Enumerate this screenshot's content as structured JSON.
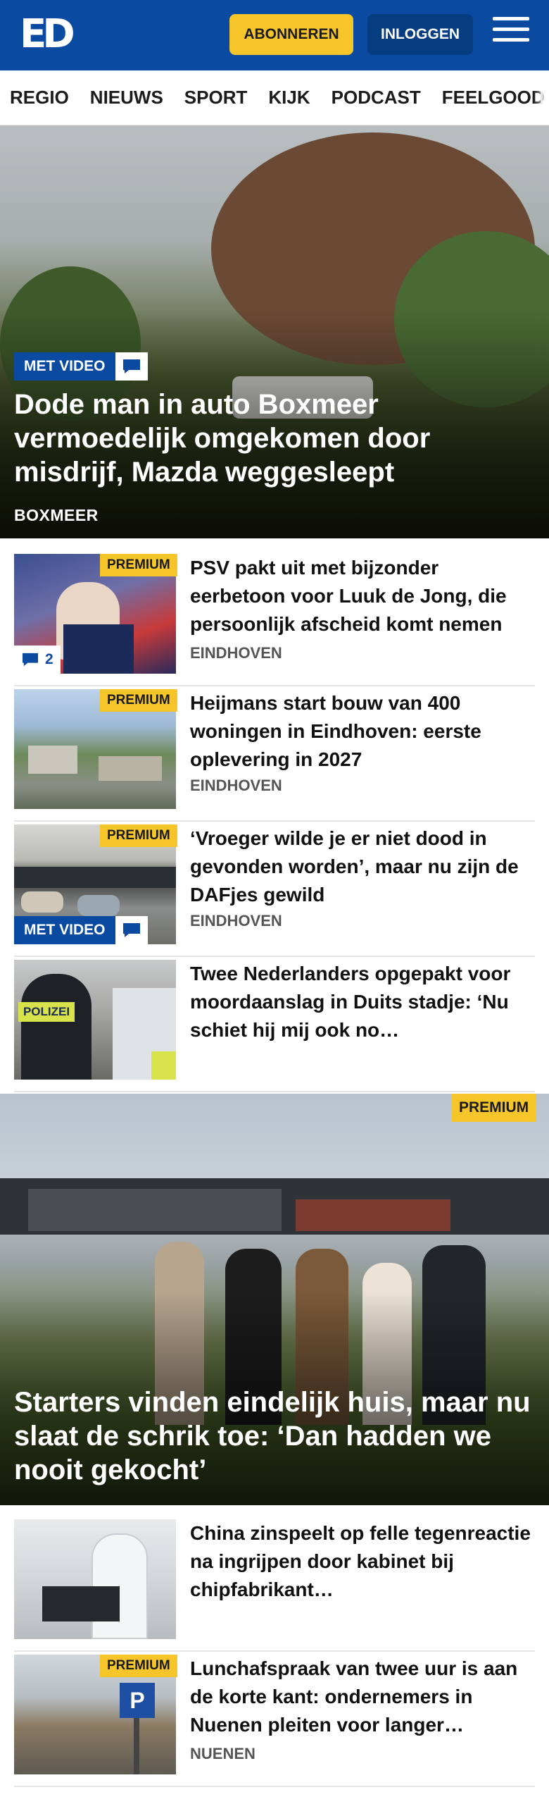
{
  "header": {
    "logo_text": "ED",
    "subscribe_label": "ABONNEREN",
    "login_label": "INLOGGEN",
    "menu_icon": "hamburger-menu-icon",
    "brand_color": "#0b4aa1",
    "accent_color": "#f5c52a"
  },
  "nav": {
    "items": [
      "REGIO",
      "NIEUWS",
      "SPORT",
      "KIJK",
      "PODCAST",
      "FEELGOOD"
    ]
  },
  "hero": {
    "badge_video": "MET VIDEO",
    "title": "Dode man in auto Boxmeer vermoedelijk omgekomen door misdrijf, Mazda weggesleept",
    "place": "BOXMEER"
  },
  "articles": [
    {
      "premium": "PREMIUM",
      "title": "PSV pakt uit met bijzonder eerbetoon voor Luuk de Jong, die persoonlijk afscheid komt nemen",
      "place": "EINDHOVEN",
      "comments": "2"
    },
    {
      "premium": "PREMIUM",
      "title": "Heijmans start bouw van 400 woningen in Eindhoven: eerste oplevering in 2027",
      "place": "EINDHOVEN"
    },
    {
      "premium": "PREMIUM",
      "badge_video": "MET VIDEO",
      "title": "‘Vroeger wilde je er niet dood in gevonden worden’, maar nu zijn de DAFjes gewild",
      "place": "EINDHOVEN"
    },
    {
      "title": "Twee Nederlanders opgepakt voor moordaanslag in Duits stadje: ‘Nu schiet hij mij ook no…",
      "thumb_text": "POLIZEI"
    }
  ],
  "big_story": {
    "premium": "PREMIUM",
    "title": "Starters vinden eindelijk huis, maar nu slaat de schrik toe: ‘Dan hadden we nooit gekocht’"
  },
  "more_articles": [
    {
      "title": "China zinspeelt op felle tegenreactie na ingrijpen door kabinet bij chipfabrikant…"
    },
    {
      "premium": "PREMIUM",
      "title": "Lunchafspraak van twee uur is aan de korte kant: ondernemers in Nuenen pleiten voor langer…",
      "place": "NUENEN"
    }
  ]
}
